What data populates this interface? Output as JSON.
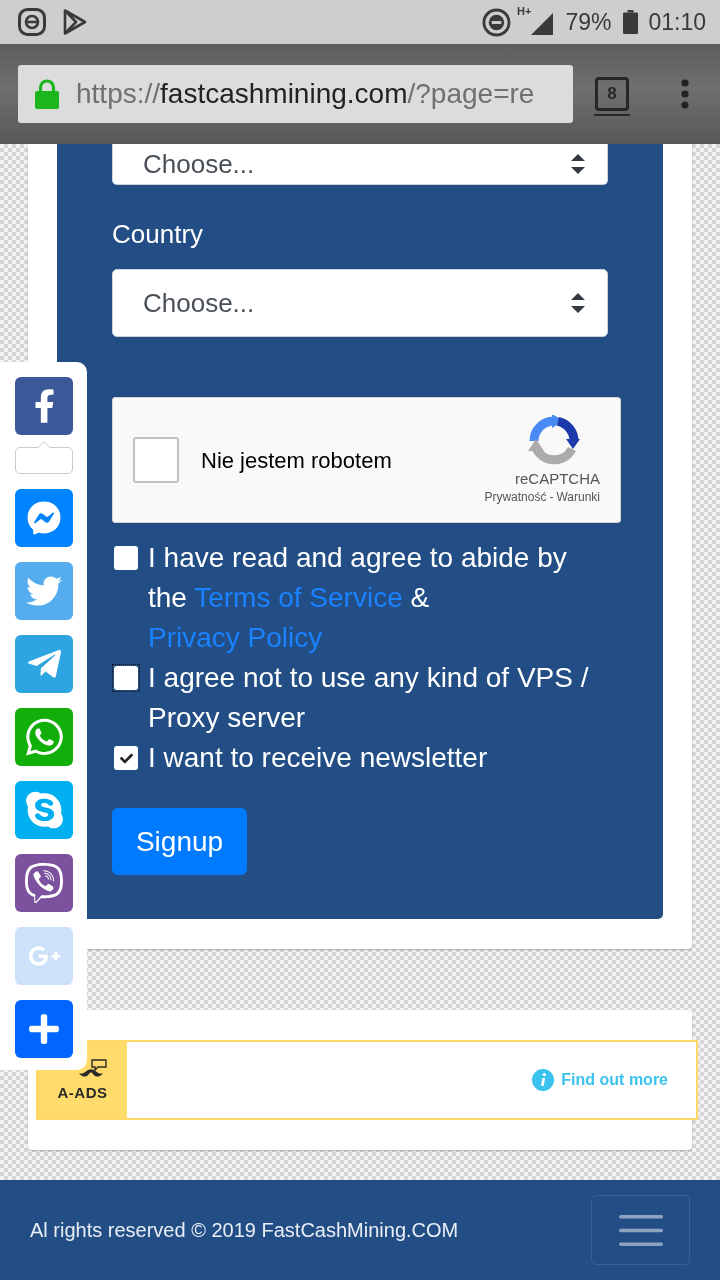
{
  "status_bar": {
    "network_type": "H+",
    "battery": "79%",
    "time": "01:10"
  },
  "browser": {
    "url": {
      "scheme": "https://",
      "host": "fastcashmining.com",
      "path": "/?page=re"
    },
    "tab_count": "8"
  },
  "form": {
    "selects": [
      {
        "value": "Choose..."
      },
      {
        "label": "Country",
        "value": "Choose..."
      }
    ],
    "recaptcha": {
      "label": "Nie jestem robotem",
      "checked": false,
      "brand": "reCAPTCHA",
      "privacy_link": "Prywatność",
      "separator": "-",
      "terms_link": "Warunki"
    },
    "agreements": [
      {
        "checked": false,
        "focused": false,
        "parts": [
          {
            "kind": "text",
            "text": "I have read and agree to abide by the "
          },
          {
            "kind": "link",
            "text": "Terms of Service"
          },
          {
            "kind": "text",
            "text": " & "
          },
          {
            "kind": "link",
            "text": "Privacy Policy"
          }
        ]
      },
      {
        "checked": false,
        "focused": true,
        "parts": [
          {
            "kind": "text",
            "text": "I agree not to use any kind of VPS / Proxy server"
          }
        ]
      },
      {
        "checked": true,
        "focused": false,
        "parts": [
          {
            "kind": "text",
            "text": "I want to receive newsletter"
          }
        ]
      }
    ],
    "submit": "Signup"
  },
  "share_bar": [
    {
      "kind": "facebook",
      "color": "#3b5998",
      "count_bubble": true
    },
    {
      "kind": "messenger",
      "color": "#0084ff",
      "count_bubble": false
    },
    {
      "kind": "twitter",
      "color": "#55acee",
      "count_bubble": false
    },
    {
      "kind": "telegram",
      "color": "#2ca5e0",
      "count_bubble": false
    },
    {
      "kind": "whatsapp",
      "color": "#12af0a",
      "count_bubble": false
    },
    {
      "kind": "skype",
      "color": "#00aff0",
      "count_bubble": false
    },
    {
      "kind": "viber",
      "color": "#7c529e",
      "count_bubble": false
    },
    {
      "kind": "googleplus",
      "color": "#cde1fb",
      "count_bubble": false
    },
    {
      "kind": "more",
      "color": "#0166ff",
      "count_bubble": false
    }
  ],
  "ad": {
    "brand": "A-ADS",
    "link": "Find out more"
  },
  "footer": {
    "copyright": "Al rights reserved © 2019 FastCashMining.COM"
  }
}
